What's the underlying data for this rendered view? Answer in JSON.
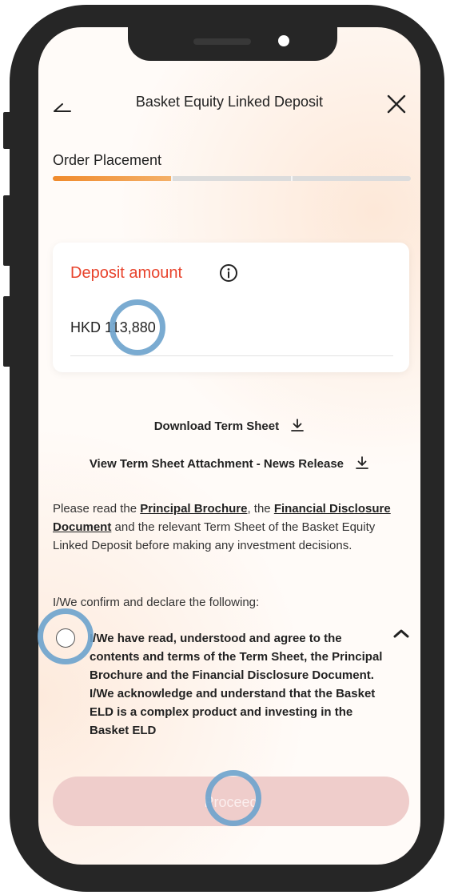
{
  "header": {
    "title": "Basket Equity Linked Deposit",
    "back_icon": "back-arrow-icon",
    "close_icon": "close-icon"
  },
  "progress": {
    "step_label": "Order Placement",
    "fraction": 0.33
  },
  "deposit": {
    "label": "Deposit amount",
    "info_icon": "info-icon",
    "currency": "HKD",
    "amount": "113,880"
  },
  "links": {
    "download_term_sheet": "Download Term Sheet",
    "view_attachment": "View Term Sheet Attachment - News Release",
    "icon": "download-icon"
  },
  "notice": {
    "text_1": "Please read the ",
    "principal_brochure": "Principal Brochure",
    "text_2": ", the ",
    "financial_disclosure": "Financial Disclosure Document",
    "text_3": " and the relevant Term Sheet of the Basket Equity Linked Deposit before making any investment decisions."
  },
  "declaration": {
    "confirm_text": "I/We confirm and declare the following:",
    "item_text": "I/We have read, understood and agree to the contents and terms of the Term Sheet, the Principal Brochure and the Financial Disclosure Document. I/We acknowledge and understand that the Basket ELD is a complex product and investing in the Basket ELD",
    "checked": false
  },
  "footer": {
    "proceed_label": "Proceed",
    "enabled": false
  },
  "colors": {
    "accent": "#e8432c",
    "progress": "#f08a2c",
    "proceed_disabled": "#efcdcb",
    "tap_marker": "#6fa4cd"
  }
}
